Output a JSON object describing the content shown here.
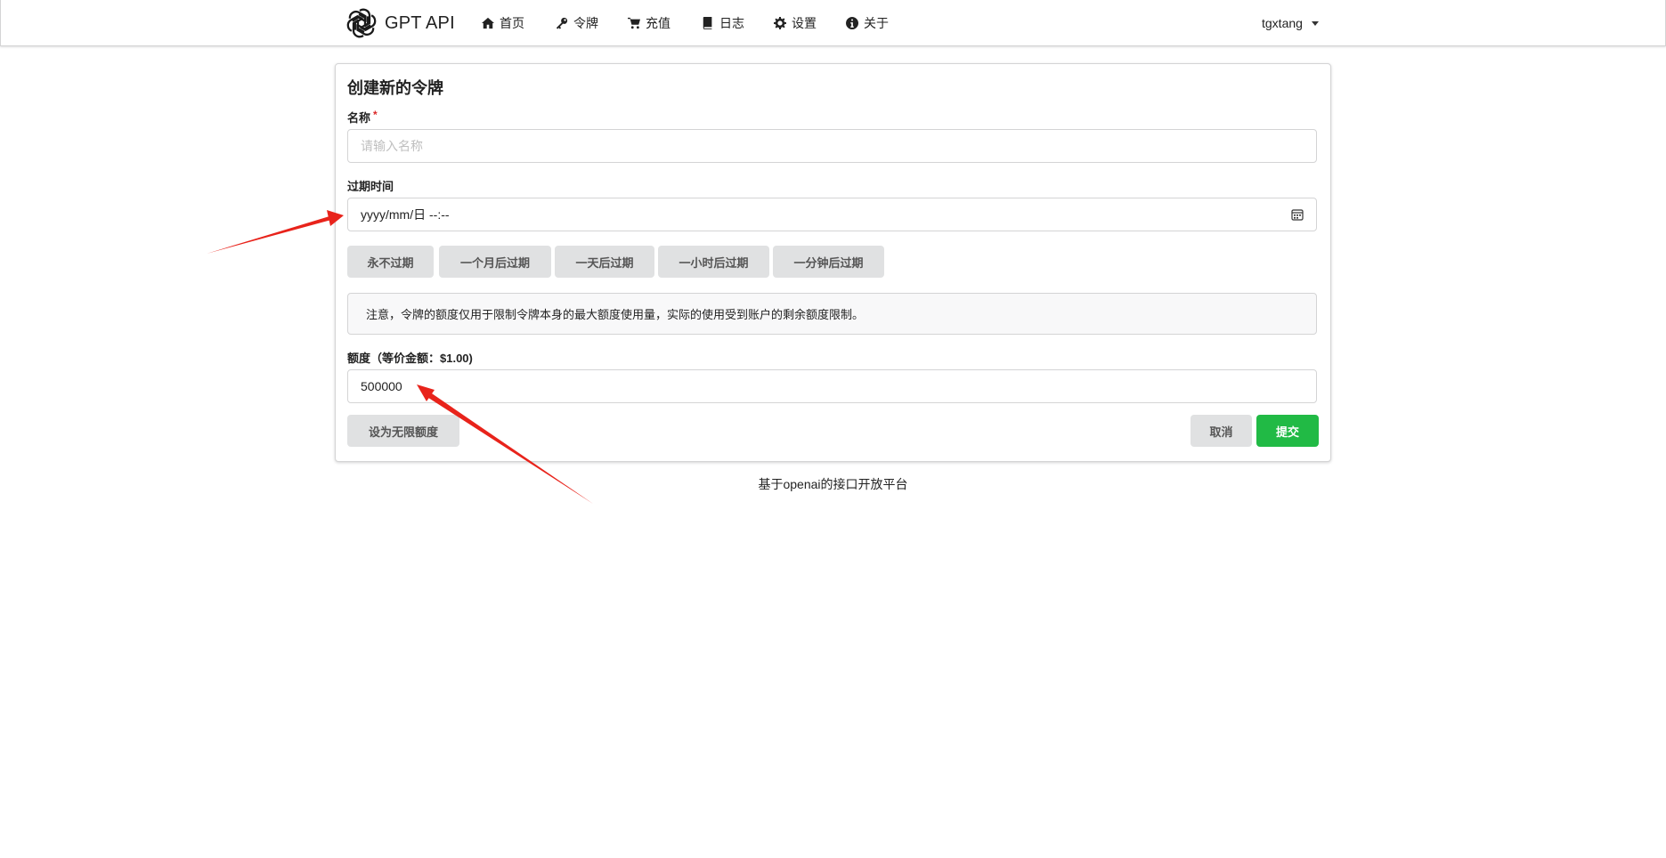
{
  "nav": {
    "brand": "GPT API",
    "items": [
      {
        "label": "首页",
        "icon": "home-icon"
      },
      {
        "label": "令牌",
        "icon": "key-icon"
      },
      {
        "label": "充值",
        "icon": "cart-icon"
      },
      {
        "label": "日志",
        "icon": "book-icon"
      },
      {
        "label": "设置",
        "icon": "gear-icon"
      },
      {
        "label": "关于",
        "icon": "info-icon"
      }
    ],
    "user": "tgxtang"
  },
  "form": {
    "title": "创建新的令牌",
    "name_label": "名称",
    "name_required_mark": "*",
    "name_placeholder": "请输入名称",
    "expire_label": "过期时间",
    "expire_value": "yyyy/mm/日 --:--",
    "expire_buttons": [
      "永不过期",
      "一个月后过期",
      "一天后过期",
      "一小时后过期",
      "一分钟后过期"
    ],
    "notice": "注意，令牌的额度仅用于限制令牌本身的最大额度使用量，实际的使用受到账户的剩余额度限制。",
    "quota_label": "额度（等价金额：$1.00)",
    "quota_value": "500000",
    "unlimited_label": "设为无限额度",
    "cancel_label": "取消",
    "submit_label": "提交"
  },
  "footer": "基于openai的接口开放平台",
  "colors": {
    "primary": "#21ba45",
    "required": "#db2828",
    "annotation_arrow": "#e8231b"
  }
}
